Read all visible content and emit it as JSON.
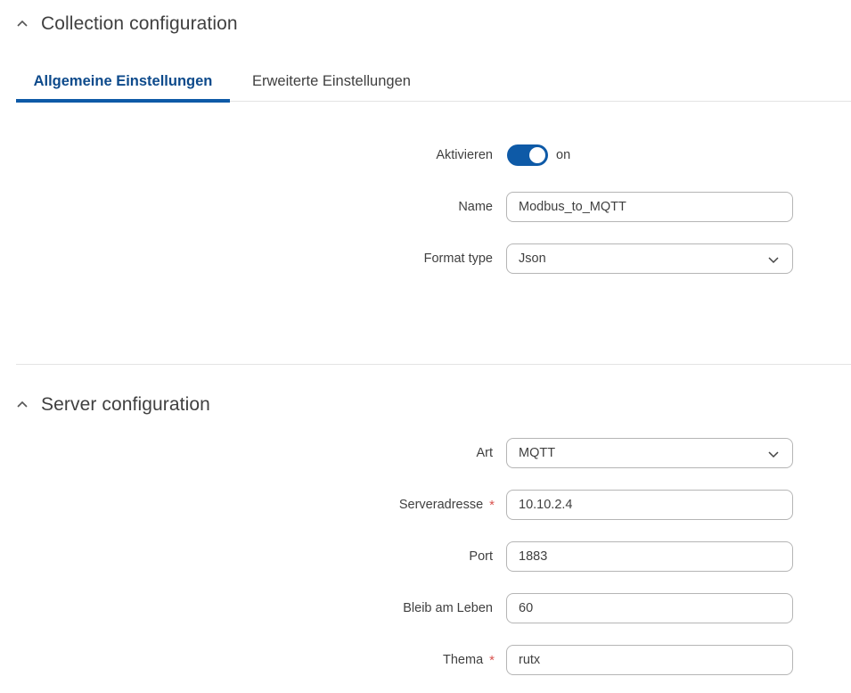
{
  "collection": {
    "title": "Collection configuration",
    "tabs": [
      {
        "label": "Allgemeine Einstellungen",
        "active": true
      },
      {
        "label": "Erweiterte Einstellungen",
        "active": false
      }
    ],
    "fields": {
      "enable": {
        "label": "Aktivieren",
        "value": "on"
      },
      "name": {
        "label": "Name",
        "value": "Modbus_to_MQTT"
      },
      "format_type": {
        "label": "Format type",
        "value": "Json"
      }
    }
  },
  "server": {
    "title": "Server configuration",
    "fields": {
      "type": {
        "label": "Art",
        "value": "MQTT"
      },
      "address": {
        "label": "Serveradresse",
        "required_mark": "*",
        "value": "10.10.2.4"
      },
      "port": {
        "label": "Port",
        "value": "1883"
      },
      "keepalive": {
        "label": "Bleib am Leben",
        "value": "60"
      },
      "topic": {
        "label": "Thema",
        "required_mark": "*",
        "value": "rutx"
      }
    }
  },
  "icons": {
    "section_collapse": "chevron-up-icon",
    "select_caret": "chevron-down-icon"
  },
  "colors": {
    "accent": "#0e5aa7",
    "active_tab_text": "#0d4a8b",
    "required": "#d9534f",
    "text": "#404040",
    "border": "#b5b5b5"
  }
}
